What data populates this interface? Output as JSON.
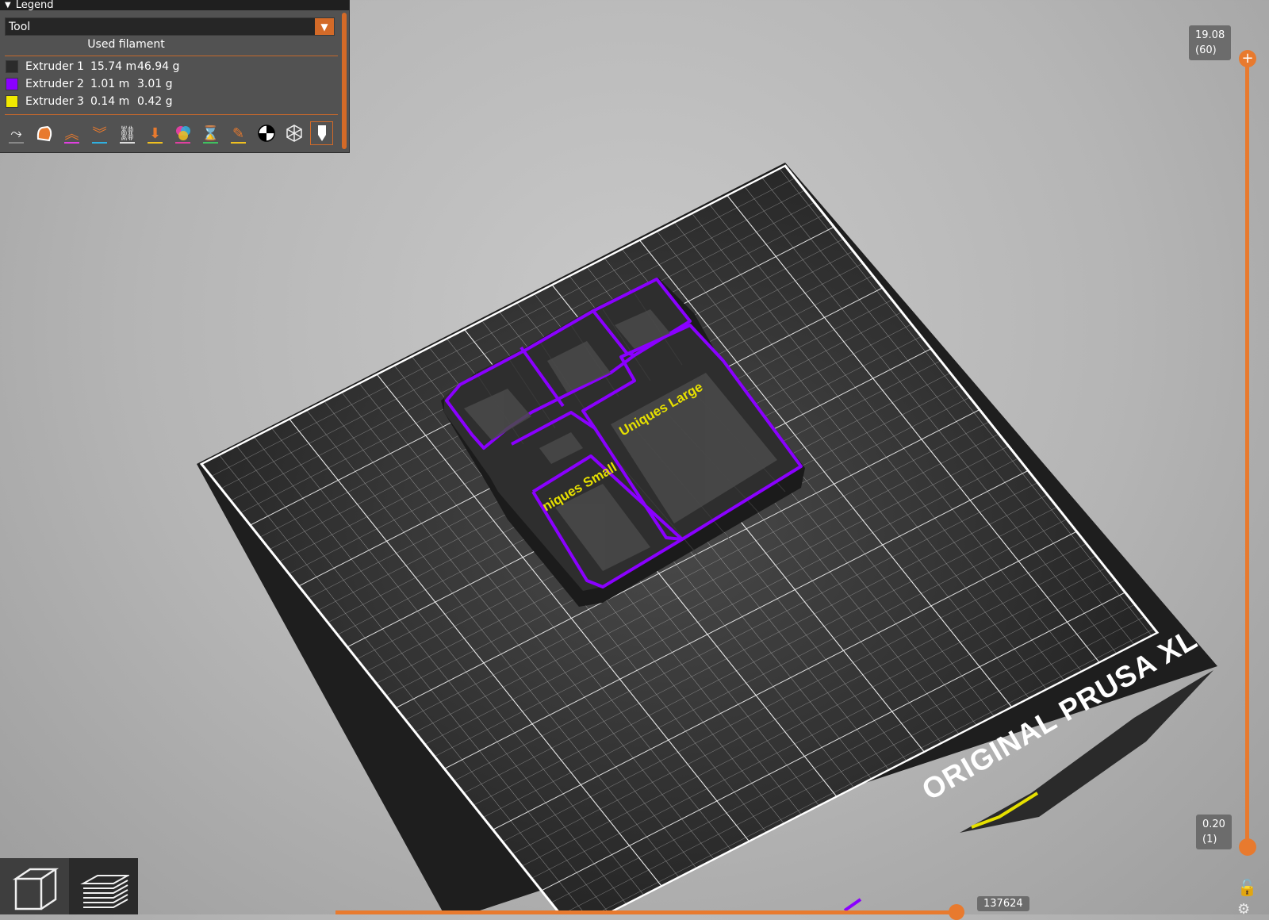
{
  "legend": {
    "header": "Legend",
    "view_type": "Tool",
    "section_title": "Used filament",
    "extruders": [
      {
        "name": "Extruder 1",
        "length": "15.74 m",
        "weight": "46.94 g",
        "color": "#2b2b2b"
      },
      {
        "name": "Extruder 2",
        "length": "1.01 m",
        "weight": "3.01 g",
        "color": "#8a00ff"
      },
      {
        "name": "Extruder 3",
        "length": "0.14 m",
        "weight": "0.42 g",
        "color": "#f0e800"
      }
    ],
    "toolbar_icons": [
      "travel-icon",
      "wipe-icon",
      "retractions-icon",
      "deretractions-icon",
      "seams-icon",
      "tool-changes-icon",
      "color-changes-icon",
      "pause-prints-icon",
      "custom-gcode-icon",
      "center-of-gravity-icon",
      "shells-icon",
      "tool-marker-icon"
    ]
  },
  "layer_slider": {
    "top_value": "19.08",
    "top_layer": "(60)",
    "bottom_value": "0.20",
    "bottom_layer": "(1)"
  },
  "move_slider": {
    "value": "137624"
  },
  "bed": {
    "brand_text": "ORIGINAL PRUSA XL"
  },
  "model": {
    "labels": [
      "Uniques Large",
      "niques Small"
    ]
  },
  "colors": {
    "accent": "#e87a2e",
    "outline": "#8a00ff",
    "label": "#f0e800"
  }
}
